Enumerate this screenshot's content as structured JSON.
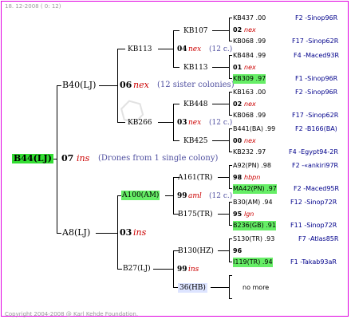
{
  "header": {
    "date": "18. 12-2008 ( 0: 12)"
  },
  "footer": {
    "copyright": "Copyright 2004-2008 @ Karl Kehde Foundation."
  },
  "root": {
    "id": "B44(LJ)",
    "year": "07",
    "label": "ins",
    "note": "(Drones from 1 single colony)"
  },
  "gen1": {
    "upper": {
      "id": "B40(LJ)"
    },
    "lower": {
      "id": "A8(LJ)"
    }
  },
  "gen2": {
    "a": {
      "id": "KB113"
    },
    "b": {
      "id": "KB266"
    },
    "c": {
      "id": "A100(AM)"
    },
    "d": {
      "id": "B27(LJ)"
    },
    "ab_year": "06",
    "ab_label": "nex",
    "ab_note": "(12 sister colonies)",
    "cd_year": "03",
    "cd_label": "ins"
  },
  "gen3": [
    {
      "id": "KB107",
      "year": "",
      "label": "",
      "note": ""
    },
    {
      "id": "",
      "year": "04",
      "label": "nex",
      "note": "(12 c.)"
    },
    {
      "id": "KB113",
      "year": "",
      "label": "",
      "note": ""
    },
    {
      "id": "KB448",
      "year": "",
      "label": "",
      "note": ""
    },
    {
      "id": "",
      "year": "03",
      "label": "nex",
      "note": "(12 c.)"
    },
    {
      "id": "KB425",
      "year": "",
      "label": "",
      "note": ""
    },
    {
      "id": "A161(TR)",
      "year": "",
      "label": "",
      "note": ""
    },
    {
      "id": "",
      "year": "99",
      "label": "aml",
      "note": "(12 c.)"
    },
    {
      "id": "B175(TR)",
      "year": "",
      "label": "",
      "note": ""
    },
    {
      "id": "B130(HZ)",
      "year": "",
      "label": "",
      "note": ""
    },
    {
      "id": "",
      "year": "99",
      "label": "ins",
      "note": ""
    },
    {
      "id": "36(HB)",
      "year": "",
      "label": "",
      "note": ""
    }
  ],
  "gen4": [
    {
      "text": "KB437 .00",
      "pedigree": "F2 -Sinop96R"
    },
    {
      "text": "02",
      "label": "nex"
    },
    {
      "text": "KB068 .99",
      "pedigree": "F17 -Sinop62R"
    },
    {
      "text": "KB484 .99",
      "pedigree": "F4 -Maced93R"
    },
    {
      "text": "01",
      "label": "nex"
    },
    {
      "text": "KB309 .97",
      "pedigree": "F1 -Sinop96R"
    },
    {
      "text": "KB163 .00",
      "pedigree": "F2 -Sinop96R"
    },
    {
      "text": "02",
      "label": "nex"
    },
    {
      "text": "KB068 .99",
      "pedigree": "F17 -Sinop62R"
    },
    {
      "text": "B441(BA) .99",
      "pedigree": "F2 -B166(BA)"
    },
    {
      "text": "00",
      "label": "nex"
    },
    {
      "text": "KB232 .97",
      "pedigree": "F4 -Egypt94-2R"
    },
    {
      "text": "A92(PN) .98",
      "pedigree": "F2 -«ankiri97R"
    },
    {
      "text": "98",
      "label": "hbpn"
    },
    {
      "text": "MA42(PN) .97",
      "pedigree": "F2 -Maced95R"
    },
    {
      "text": "B30(AM) .94",
      "pedigree": "F12 -Sinop72R"
    },
    {
      "text": "95",
      "label": "lgn"
    },
    {
      "text": "B236(GB) .91",
      "pedigree": "F11 -Sinop72R"
    },
    {
      "text": "S130(TR) .93",
      "pedigree": "F7 -Atlas85R"
    },
    {
      "text": "96",
      "label": ""
    },
    {
      "text": "I119(TR) .94",
      "pedigree": "F1 -Takab93aR"
    },
    {
      "text": "no more",
      "pedigree": ""
    }
  ],
  "colors": {
    "border": "#e000e0",
    "highlight": "#66ee66",
    "nex": "#cc0000",
    "pedigree": "#00008b"
  }
}
